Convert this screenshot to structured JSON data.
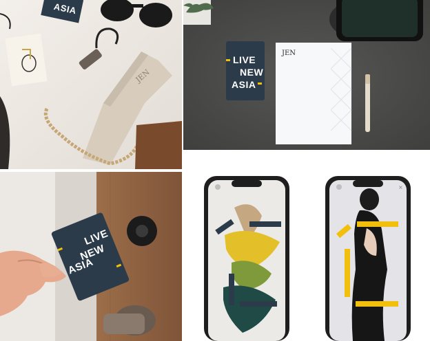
{
  "brand": {
    "card_line1": "LIVE",
    "card_line2": "NEW",
    "card_line3": "ASIA",
    "logo_mark": "JEN",
    "accent_color": "#f2c00c",
    "card_color": "#2b3b4a"
  },
  "panels": {
    "top_left": "flat-lay",
    "top_right": "stationery",
    "bottom_left": "key-card-door",
    "bottom_right": "phone-mockups"
  }
}
